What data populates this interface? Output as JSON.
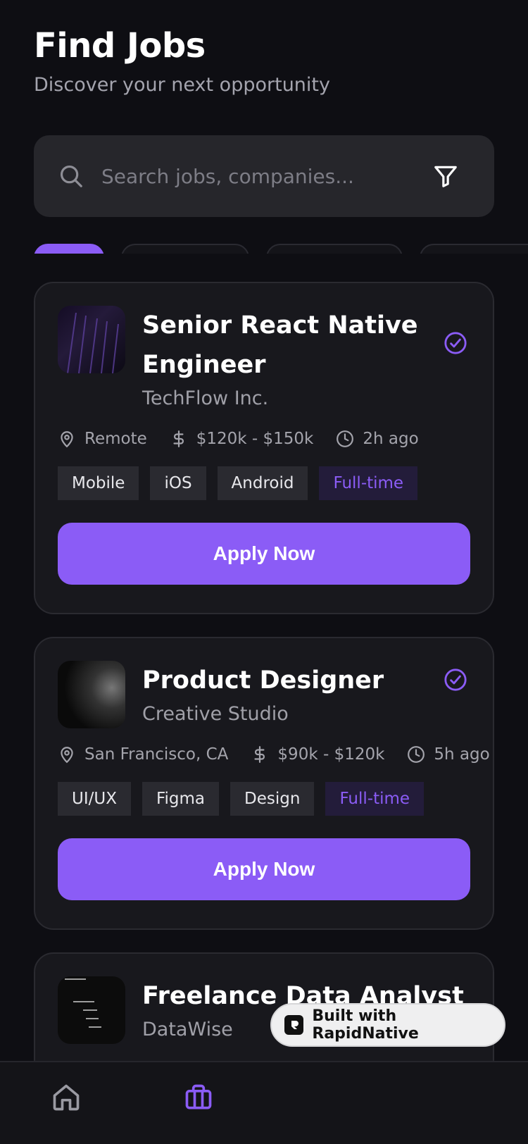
{
  "header": {
    "title": "Find Jobs",
    "subtitle": "Discover your next opportunity"
  },
  "search": {
    "placeholder": "Search jobs, companies...",
    "icon": "search-icon",
    "filter_icon": "filter-icon"
  },
  "jobs": [
    {
      "title": "Senior React Native Engineer",
      "company": "TechFlow Inc.",
      "location": "Remote",
      "salary": "$120k - $150k",
      "posted": "2h ago",
      "tags": [
        "Mobile",
        "iOS",
        "Android"
      ],
      "type": "Full-time",
      "verified": true,
      "apply_label": "Apply Now"
    },
    {
      "title": "Product Designer",
      "company": "Creative Studio",
      "location": "San Francisco, CA",
      "salary": "$90k - $120k",
      "posted": "5h ago",
      "tags": [
        "UI/UX",
        "Figma",
        "Design"
      ],
      "type": "Full-time",
      "verified": true,
      "apply_label": "Apply Now"
    },
    {
      "title": "Freelance Data Analyst",
      "company": "DataWise"
    }
  ],
  "badge": {
    "label": "Built with RapidNative"
  },
  "colors": {
    "accent": "#8b5cf6",
    "background": "#0e0e13",
    "card": "#18181d"
  },
  "tabbar": {
    "icons": [
      "home-icon",
      "briefcase-icon"
    ]
  }
}
